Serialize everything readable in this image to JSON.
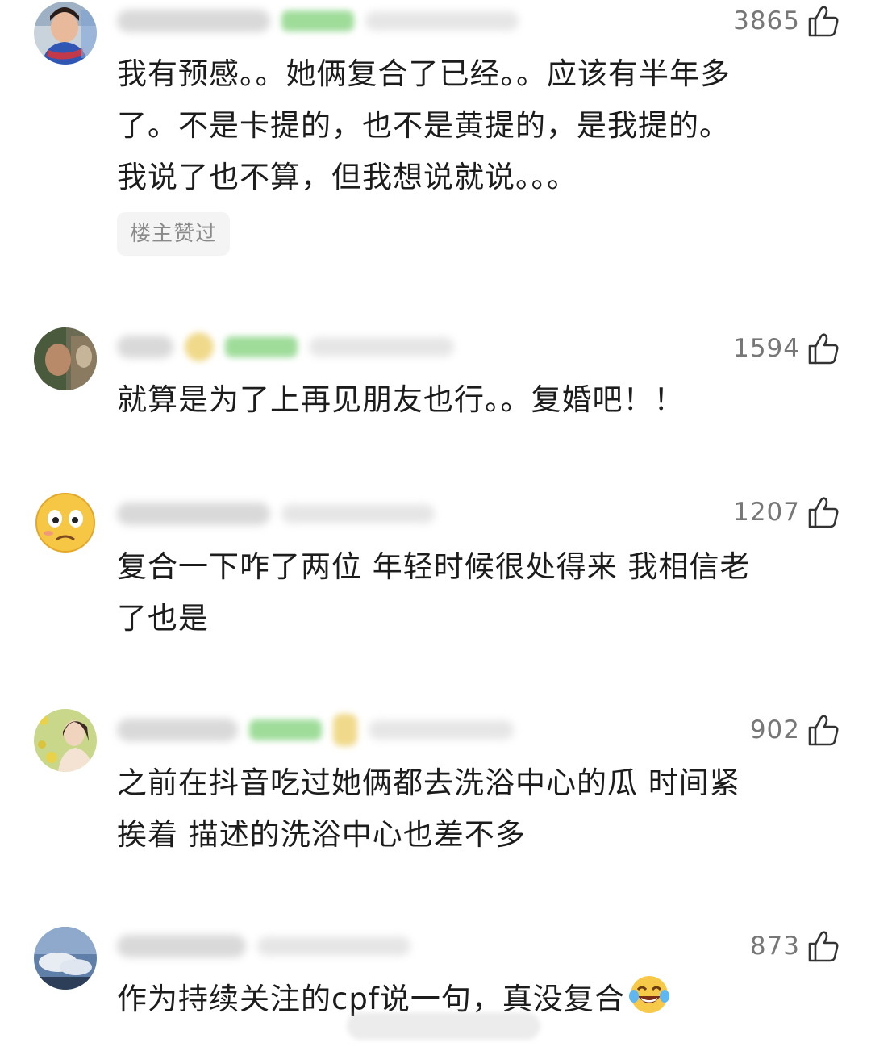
{
  "comments": [
    {
      "likes": "3865",
      "text": "我有预感。。她俩复合了已经。。应该有半年多\n了。不是卡提的，也不是黄提的，是我提的。\n我说了也不算，但我想说就说。。。",
      "badge": "楼主赞过",
      "avatar_icon": "avatar-girl-scarf-icon"
    },
    {
      "likes": "1594",
      "text": "就算是为了上再见朋友也行。。复婚吧！！",
      "avatar_icon": "avatar-photo-icon"
    },
    {
      "likes": "1207",
      "text": "复合一下咋了两位 年轻时候很处得来 我相信老\n了也是",
      "avatar_icon": "avatar-sad-emoji-icon"
    },
    {
      "likes": "902",
      "text": "之前在抖音吃过她俩都去洗浴中心的瓜 时间紧\n挨着 描述的洗浴中心也差不多",
      "avatar_icon": "avatar-woman-flowers-icon"
    },
    {
      "likes": "873",
      "text": "作为持续关注的cpf说一句，真没复合",
      "emoji": "laugh-cry-emoji-icon",
      "avatar_icon": "avatar-sky-clouds-icon"
    }
  ],
  "icons": {
    "like": "thumbs-up-icon"
  },
  "colors": {
    "text": "#1c1c1c",
    "like_count": "#777777",
    "badge_bg": "#f4f4f4",
    "badge_text": "#8a8a8a"
  }
}
